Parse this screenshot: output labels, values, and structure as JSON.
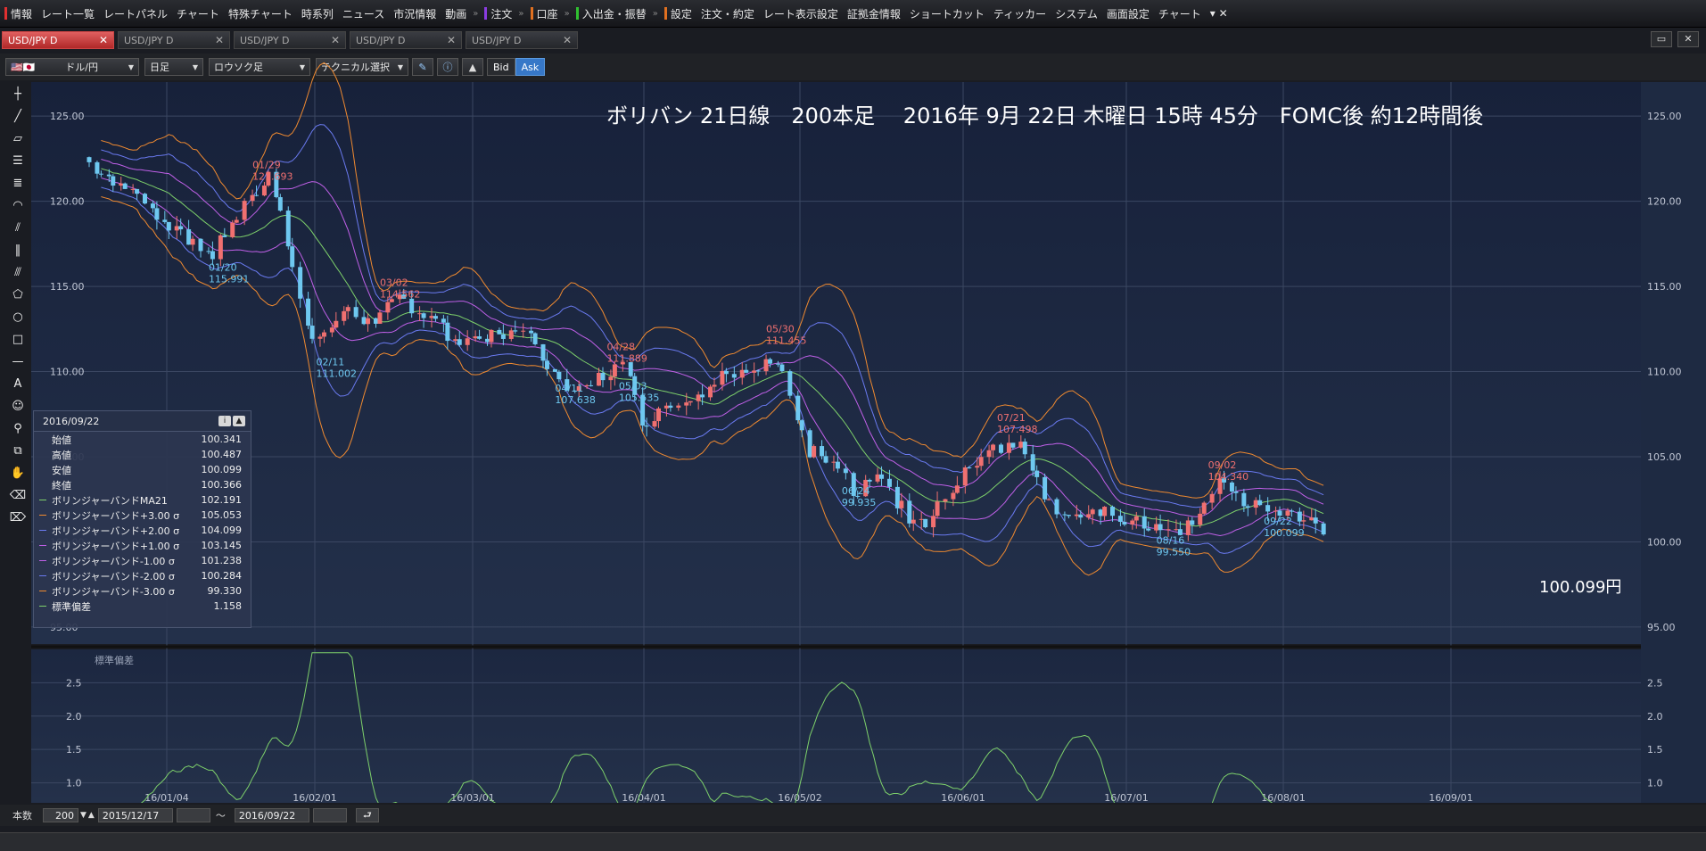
{
  "menu": [
    {
      "label": "情報",
      "mark": "#e03030"
    },
    {
      "label": "レート一覧",
      "mark": ""
    },
    {
      "label": "レートパネル",
      "mark": ""
    },
    {
      "label": "チャート",
      "mark": ""
    },
    {
      "label": "特殊チャート",
      "mark": ""
    },
    {
      "label": "時系列",
      "mark": ""
    },
    {
      "label": "ニュース",
      "mark": ""
    },
    {
      "label": "市況情報",
      "mark": ""
    },
    {
      "label": "動画",
      "mark": ""
    },
    {
      "label": "注文",
      "mark": "#8a3ce0",
      "sep": true
    },
    {
      "label": "口座",
      "mark": "#e07020",
      "sep": true
    },
    {
      "label": "入出金・振替",
      "mark": "#30c030",
      "sep": true
    },
    {
      "label": "設定",
      "mark": "#e07020",
      "sep": true
    },
    {
      "label": "注文・約定",
      "mark": ""
    },
    {
      "label": "レート表示設定",
      "mark": ""
    },
    {
      "label": "証拠金情報",
      "mark": ""
    },
    {
      "label": "ショートカット",
      "mark": ""
    },
    {
      "label": "ティッカー",
      "mark": ""
    },
    {
      "label": "システム",
      "mark": ""
    },
    {
      "label": "画面設定",
      "mark": ""
    },
    {
      "label": "チャート",
      "mark": ""
    }
  ],
  "tabs": [
    {
      "label": "USD/JPY D",
      "active": true
    },
    {
      "label": "USD/JPY D",
      "active": false
    },
    {
      "label": "USD/JPY D",
      "active": false
    },
    {
      "label": "USD/JPY D",
      "active": false
    },
    {
      "label": "USD/JPY D",
      "active": false
    }
  ],
  "toolbar": {
    "pair": "ドル/円",
    "period": "日足",
    "style": "ロウソク足",
    "technical": "テクニカル選択",
    "bid": "Bid",
    "ask": "Ask"
  },
  "infobox": {
    "date": "2016/09/22",
    "rows": [
      {
        "label": "始値",
        "value": "100.341",
        "color": ""
      },
      {
        "label": "高値",
        "value": "100.487",
        "color": ""
      },
      {
        "label": "安値",
        "value": "100.099",
        "color": ""
      },
      {
        "label": "終値",
        "value": "100.366",
        "color": ""
      },
      {
        "label": "ボリンジャーバンドMA21",
        "value": "102.191",
        "color": "#7ed16b"
      },
      {
        "label": "ボリンジャーバンド+3.00 σ",
        "value": "105.053",
        "color": "#f08a30"
      },
      {
        "label": "ボリンジャーバンド+2.00 σ",
        "value": "104.099",
        "color": "#6a7af0"
      },
      {
        "label": "ボリンジャーバンド+1.00 σ",
        "value": "103.145",
        "color": "#c060e8"
      },
      {
        "label": "ボリンジャーバンド-1.00 σ",
        "value": "101.238",
        "color": "#c060e8"
      },
      {
        "label": "ボリンジャーバンド-2.00 σ",
        "value": "100.284",
        "color": "#6a7af0"
      },
      {
        "label": "ボリンジャーバンド-3.00 σ",
        "value": "99.330",
        "color": "#f08a30"
      },
      {
        "label": "標準偏差",
        "value": "1.158",
        "color": "#7ed16b"
      }
    ]
  },
  "bottom": {
    "count_label": "本数",
    "count": "200",
    "from": "2015/12/17",
    "tilde": "～",
    "to": "2016/09/22"
  },
  "chart_data": {
    "type": "candlestick",
    "title": "ボリバン 21日線　200本足　 2016年 9月 22日 木曜日 15時 45分　FOMC後 約12時間後",
    "price_label": "100.099円",
    "ylim": [
      94,
      127
    ],
    "y_ticks": [
      "95.00",
      "100.00",
      "105.00",
      "110.00",
      "115.00",
      "120.00",
      "125.00"
    ],
    "x_ticks": [
      "16/01/04",
      "16/02/01",
      "16/03/01",
      "16/04/01",
      "16/05/02",
      "16/06/01",
      "16/07/01",
      "16/08/01",
      "16/09/01"
    ],
    "anchors": [
      [
        0,
        122.3
      ],
      [
        12,
        120.3
      ],
      [
        25,
        117.5
      ],
      [
        31,
        116.8
      ],
      [
        36,
        118.7
      ],
      [
        41,
        120.5
      ],
      [
        46,
        121.6
      ],
      [
        51,
        116.0
      ],
      [
        57,
        111.6
      ],
      [
        64,
        113.6
      ],
      [
        71,
        112.8
      ],
      [
        78,
        114.3
      ],
      [
        86,
        113.1
      ],
      [
        94,
        111.4
      ],
      [
        103,
        112.4
      ],
      [
        112,
        111.9
      ],
      [
        119,
        108.8
      ],
      [
        127,
        109.5
      ],
      [
        135,
        110.8
      ],
      [
        139,
        106.6
      ],
      [
        147,
        108.3
      ],
      [
        155,
        109.0
      ],
      [
        161,
        110.0
      ],
      [
        167,
        109.9
      ],
      [
        172,
        110.7
      ],
      [
        175,
        109.3
      ],
      [
        180,
        105.5
      ],
      [
        188,
        104.3
      ],
      [
        193,
        102.8
      ],
      [
        199,
        104.0
      ],
      [
        205,
        101.6
      ],
      [
        210,
        101.1
      ],
      [
        215,
        102.6
      ],
      [
        221,
        104.3
      ],
      [
        227,
        105.7
      ],
      [
        235,
        105.5
      ],
      [
        241,
        102.3
      ],
      [
        248,
        101.4
      ],
      [
        256,
        101.7
      ],
      [
        264,
        101.0
      ],
      [
        270,
        100.5
      ],
      [
        277,
        100.9
      ],
      [
        283,
        103.6
      ],
      [
        289,
        102.6
      ],
      [
        295,
        101.8
      ],
      [
        302,
        102.0
      ],
      [
        310,
        100.4
      ]
    ],
    "annotations": [
      {
        "date": "01/29",
        "value": "121.693",
        "i": 41,
        "type": "high"
      },
      {
        "date": "01/20",
        "value": "115.991",
        "i": 30,
        "type": "low"
      },
      {
        "date": "02/11",
        "value": "111.002",
        "i": 57,
        "type": "low"
      },
      {
        "date": "03/02",
        "value": "114.562",
        "i": 73,
        "type": "high"
      },
      {
        "date": "04/11",
        "value": "107.638",
        "i": 117,
        "type": "low"
      },
      {
        "date": "04/28",
        "value": "111.889",
        "i": 130,
        "type": "high"
      },
      {
        "date": "05/03",
        "value": "105.535",
        "i": 133,
        "type": "low"
      },
      {
        "date": "05/30",
        "value": "111.455",
        "i": 170,
        "type": "high"
      },
      {
        "date": "06/24",
        "value": "99.935",
        "i": 189,
        "type": "low"
      },
      {
        "date": "07/21",
        "value": "107.498",
        "i": 228,
        "type": "high"
      },
      {
        "date": "08/16",
        "value": "99.550",
        "i": 268,
        "type": "low"
      },
      {
        "date": "09/02",
        "value": "104.340",
        "i": 281,
        "type": "high"
      },
      {
        "date": "09/22",
        "value": "100.099",
        "i": 295,
        "type": "low"
      }
    ],
    "sub_panel": {
      "label": "標準偏差",
      "ylim": [
        0.7,
        3.0
      ],
      "y_ticks": [
        "1.0",
        "1.5",
        "2.0",
        "2.5"
      ]
    },
    "colors": {
      "up": "#f07070",
      "down": "#6ec8f0",
      "ma": "#7ed16b",
      "s1": "#c060e8",
      "s2": "#6a7af0",
      "s3": "#f08a30"
    }
  }
}
